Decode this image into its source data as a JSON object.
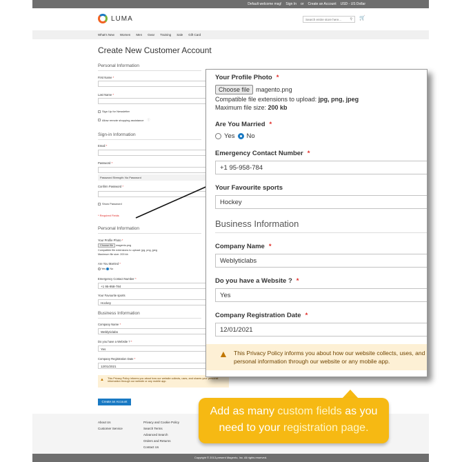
{
  "topbar": {
    "welcome": "Default welcome msg!",
    "sign_in": "Sign In",
    "or": "or",
    "create_account": "Create an Account",
    "currency": "USD - US Dollar"
  },
  "header": {
    "logo_text": "LUMA",
    "search_placeholder": "Search entire store here..."
  },
  "nav": {
    "items": [
      "What's New",
      "Women",
      "Men",
      "Gear",
      "Training",
      "Sale",
      "Gift Card"
    ]
  },
  "form": {
    "title": "Create New Customer Account",
    "personal_info_title": "Personal Information",
    "first_name_label": "First Name",
    "last_name_label": "Last Name",
    "newsletter_label": "Sign Up for Newsletter",
    "remote_assist_label": "Allow remote shopping assistance",
    "signin_title": "Sign-in Information",
    "email_label": "Email",
    "password_label": "Password",
    "password_strength": "Password Strength: No Password",
    "confirm_password_label": "Confirm Password",
    "show_password_label": "Show Password",
    "required_note": "* Required Fields",
    "personal_info2_title": "Personal Information",
    "profile_photo_label": "Your Profile Photo",
    "choose_file_small": "Choose file",
    "file_name_small": "magento.png",
    "ext_small": "Compatible file extensions to upload: jpg, png, jpeg",
    "size_small": "Maximum file size: 200 kb",
    "married_label": "Are You Married",
    "yes_small": "Yes",
    "no_small": "No",
    "emergency_label": "Emergency Contact Number",
    "emergency_value": "+1 95-958-784",
    "sports_label": "Your Favourite sports",
    "sports_value": "Hockey",
    "business_title": "Business Information",
    "company_name_label": "Company Name",
    "company_name_value": "Weblyticlabs",
    "website_label": "Do you have a Website ?",
    "website_value": "Yes",
    "reg_date_label": "Company Registration Date",
    "reg_date_value": "12/01/2021",
    "privacy_small": "This Privacy Policy informs you about how our website collects, uses, and shares your personal information through our website or any mobile app.",
    "create_button": "Create an Account"
  },
  "footer": {
    "col1": [
      "About Us",
      "Customer Service"
    ],
    "col2": [
      "Privacy and Cookie Policy",
      "Search Terms",
      "Advanced Search",
      "Orders and Returns",
      "Contact Us"
    ],
    "copyright": "Copyright © 2013-present Magento, Inc. All rights reserved."
  },
  "zoom": {
    "profile_photo_label": "Your Profile Photo",
    "choose_file": "Choose file",
    "file_name": "magento.png",
    "ext_prefix": "Compatible file extensions to upload: ",
    "ext_values": "jpg, png, jpeg",
    "size_prefix": "Maximum file size: ",
    "size_value": "200 kb",
    "married_label": "Are You Married",
    "yes": "Yes",
    "no": "No",
    "emergency_label": "Emergency Contact Number",
    "emergency_value": "+1 95-958-784",
    "sports_label": "Your Favourite sports",
    "sports_value": "Hockey",
    "business_title": "Business Information",
    "company_name_label": "Company Name",
    "company_name_value": "Weblyticlabs",
    "website_label": "Do you have a Website ?",
    "website_value": "Yes",
    "reg_date_label": "Company Registration Date",
    "reg_date_value": "12/01/2021",
    "privacy_line1": "This Privacy Policy informs you about how our website collects, uses, and",
    "privacy_line2": "personal information through our website or any mobile app."
  },
  "banner": {
    "line1_a": "Add as many ",
    "line1_hl": "custom fields",
    "line1_b": " as you",
    "line2_a": "need to your ",
    "line2_hl": "registration page."
  },
  "colors": {
    "accent": "#1979c3",
    "banner": "#f6b913",
    "required": "#e02b27",
    "notice_bg": "#fdf0d5"
  },
  "icons": {
    "search": "search-icon",
    "cart": "cart-icon",
    "warning": "warning-icon",
    "help": "help-icon"
  }
}
